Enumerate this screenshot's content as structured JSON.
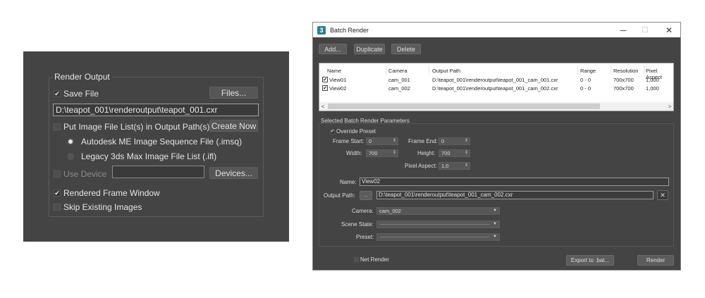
{
  "render_output": {
    "group_title": "Render Output",
    "save_file_label": "Save File",
    "save_file_checked": true,
    "files_button": "Files...",
    "output_path": "D:\\teapot_001\\renderoutput\\teapot_001.cxr",
    "put_image_list_label": "Put Image File List(s) in Output Path(s)",
    "create_now_button": "Create Now",
    "radio_imsq_label": "Autodesk ME Image Sequence File (.imsq)",
    "radio_ifl_label": "Legacy 3ds Max Image File List (.ifl)",
    "use_device_label": "Use Device",
    "devices_button": "Devices...",
    "rendered_frame_window_label": "Rendered Frame Window",
    "rendered_frame_window_checked": true,
    "skip_existing_label": "Skip Existing Images"
  },
  "batch_render": {
    "title": "Batch Render",
    "app_icon_glyph": "3",
    "window_controls": {
      "minimize": "─",
      "maximize": "☐",
      "close": "✕"
    },
    "toolbar": {
      "add": "Add...",
      "duplicate": "Duplicate",
      "delete": "Delete"
    },
    "columns": [
      "Name",
      "Camera",
      "Output Path",
      "Range",
      "Resolution",
      "Pixel Aspect"
    ],
    "rows": [
      {
        "name": "View01",
        "camera": "cam_001",
        "output_path": "D:\\teapot_001\\renderoutput\\teapot_001_cam_001.cxr",
        "range": "0 - 0",
        "resolution": "700x700",
        "pixel_aspect": "1,000",
        "checked": true
      },
      {
        "name": "View02",
        "camera": "cam_002",
        "output_path": "D:\\teapot_001\\renderoutput\\teapot_001_cam_002.cxr",
        "range": "0 - 0",
        "resolution": "700x700",
        "pixel_aspect": "1,000",
        "checked": true
      }
    ],
    "scroll_left": "<",
    "scroll_right": ">",
    "params": {
      "section_title": "Selected Batch Render Parameters",
      "override_preset_label": "Override Preset",
      "override_preset_checked": true,
      "frame_start_label": "Frame Start:",
      "frame_start_value": "0",
      "frame_end_label": "Frame End:",
      "frame_end_value": "0",
      "width_label": "Width:",
      "width_value": "700",
      "height_label": "Height:",
      "height_value": "700",
      "pixel_aspect_label": "Pixel Aspect:",
      "pixel_aspect_value": "1,0",
      "name_label": "Name:",
      "name_value": "View02",
      "output_path_label": "Output Path:",
      "output_path_browse": "...",
      "output_path_value": "D:\\teapot_001\\renderoutput\\teapot_001_cam_002.cxr",
      "clear_icon_glyph": "✕",
      "camera_label": "Camera:",
      "camera_value": "cam_002",
      "scene_state_label": "Scene State:",
      "preset_label": "Preset:",
      "dropdown_arrow": "▼",
      "spin_arrows": "⇕"
    },
    "net_render_label": "Net Render",
    "export_button": "Export to .bat...",
    "render_button": "Render"
  }
}
